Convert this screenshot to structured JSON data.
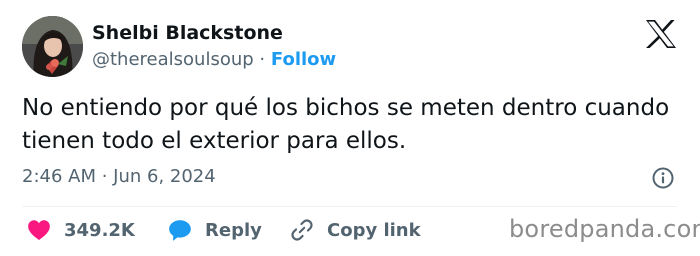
{
  "tweet": {
    "author": {
      "display_name": "Shelbi Blackstone",
      "handle": "@therealsoulsoup",
      "separator": "·",
      "follow_label": "Follow"
    },
    "text": "No entiendo por qué los bichos se meten dentro cuando tienen todo el exterior para ellos.",
    "timestamp": "2:46 AM · Jun 6, 2024",
    "actions": {
      "likes": {
        "icon": "heart-icon",
        "count": "349.2K"
      },
      "reply": {
        "icon": "speech-bubble-icon",
        "label": "Reply"
      },
      "copy_link": {
        "icon": "link-icon",
        "label": "Copy link"
      }
    },
    "platform_logo": "x-logo-icon",
    "info": "info-icon"
  },
  "watermark": "boredpanda.com",
  "colors": {
    "text": "#0f1419",
    "secondary_text": "#536471",
    "link_blue": "#1d9bf0",
    "like_pink": "#f91880",
    "divider": "#eff3f4",
    "watermark": "#8c8c8c"
  }
}
